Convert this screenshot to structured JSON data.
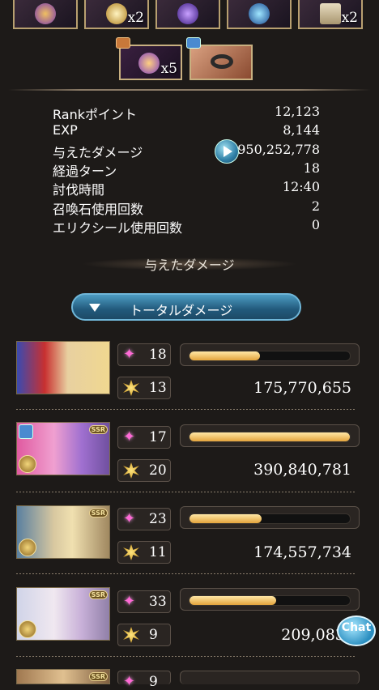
{
  "top_rewards": [
    {
      "icon": "feather-item-icon",
      "count": ""
    },
    {
      "icon": "gold-emblem-icon",
      "count": "x2"
    },
    {
      "icon": "purple-orb-icon",
      "count": ""
    },
    {
      "icon": "blue-orb-icon",
      "count": ""
    },
    {
      "icon": "scroll-icon",
      "count": "x2"
    }
  ],
  "drops": [
    {
      "icon": "feather-item-icon",
      "count": "x5",
      "chest": "treasure-chest-icon"
    },
    {
      "icon": "ring-icon",
      "count": "",
      "chest": "blue-chest-icon"
    }
  ],
  "stats": [
    {
      "label": "Rankポイント",
      "value": "12,123"
    },
    {
      "label": "EXP",
      "value": "8,144"
    },
    {
      "label": "与えたダメージ",
      "value": "950,252,778"
    },
    {
      "label": "経過ターン",
      "value": "18"
    },
    {
      "label": "討伐時間",
      "value": "12:40"
    },
    {
      "label": "召喚石使用回数",
      "value": "2"
    },
    {
      "label": "エリクシール使用回数",
      "value": "0"
    }
  ],
  "section_title": "与えたダメージ",
  "total_damage_button": "トータルダメージ",
  "members": [
    {
      "skills": "18",
      "charge": "13",
      "bar_fraction": 0.44,
      "damage": "175,770,655",
      "rarity": ""
    },
    {
      "skills": "17",
      "charge": "20",
      "bar_fraction": 1.0,
      "damage": "390,840,781",
      "rarity": "SSR"
    },
    {
      "skills": "23",
      "charge": "11",
      "bar_fraction": 0.45,
      "damage": "174,557,734",
      "rarity": "SSR"
    },
    {
      "skills": "33",
      "charge": "9",
      "bar_fraction": 0.54,
      "damage": "209,083,6",
      "rarity": "SSR"
    },
    {
      "skills": "9",
      "charge": "",
      "bar_fraction": 0,
      "damage": "",
      "rarity": "SSR"
    }
  ],
  "chat_label": "Chat"
}
